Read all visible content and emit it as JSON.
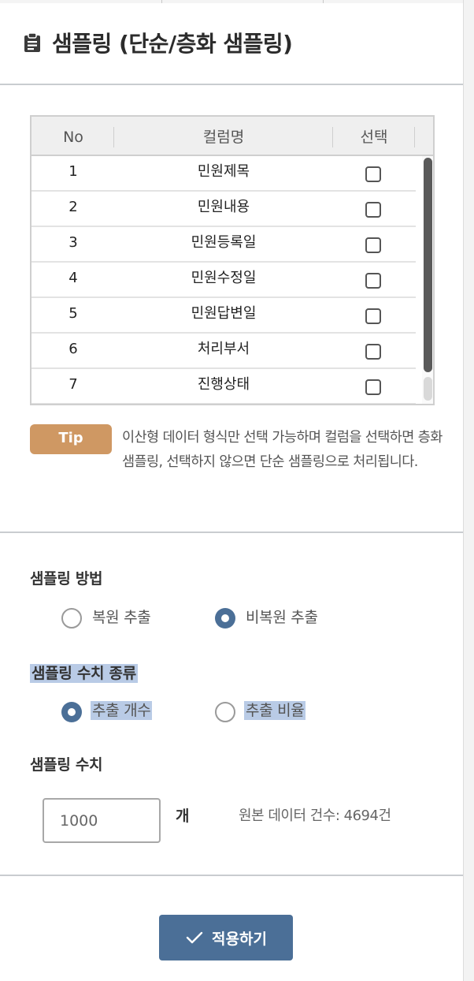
{
  "header": {
    "title": "샘플링 (단순/층화 샘플링)",
    "icon": "clipboard-icon"
  },
  "table": {
    "headers": {
      "no": "No",
      "column": "컬럼명",
      "select": "선택"
    },
    "rows": [
      {
        "no": "1",
        "column": "민원제목",
        "checked": false
      },
      {
        "no": "2",
        "column": "민원내용",
        "checked": false
      },
      {
        "no": "3",
        "column": "민원등록일",
        "checked": false
      },
      {
        "no": "4",
        "column": "민원수정일",
        "checked": false
      },
      {
        "no": "5",
        "column": "민원답변일",
        "checked": false
      },
      {
        "no": "6",
        "column": "처리부서",
        "checked": false
      },
      {
        "no": "7",
        "column": "진행상태",
        "checked": false
      }
    ]
  },
  "tip": {
    "badge": "Tip",
    "text": "이산형 데이터 형식만 선택 가능하며 컬럼을 선택하면 층화 샘플링, 선택하지 않으면 단순 샘플링으로 처리됩니다."
  },
  "method": {
    "label": "샘플링 방법",
    "options": [
      {
        "label": "복원 추출",
        "selected": false
      },
      {
        "label": "비복원 추출",
        "selected": true
      }
    ]
  },
  "count_type": {
    "label": "샘플링 수치 종류",
    "options": [
      {
        "label": "추출 개수",
        "selected": true
      },
      {
        "label": "추출 비율",
        "selected": false
      }
    ]
  },
  "count": {
    "label": "샘플링 수치",
    "value": "1000",
    "unit": "개",
    "origin_text": "원본 데이터 건수: 4694건"
  },
  "apply_button": {
    "label": "적용하기",
    "icon": "check-icon"
  },
  "colors": {
    "accent": "#4b6f97",
    "tip": "#cf9863",
    "highlight": "#b9cbe6"
  }
}
